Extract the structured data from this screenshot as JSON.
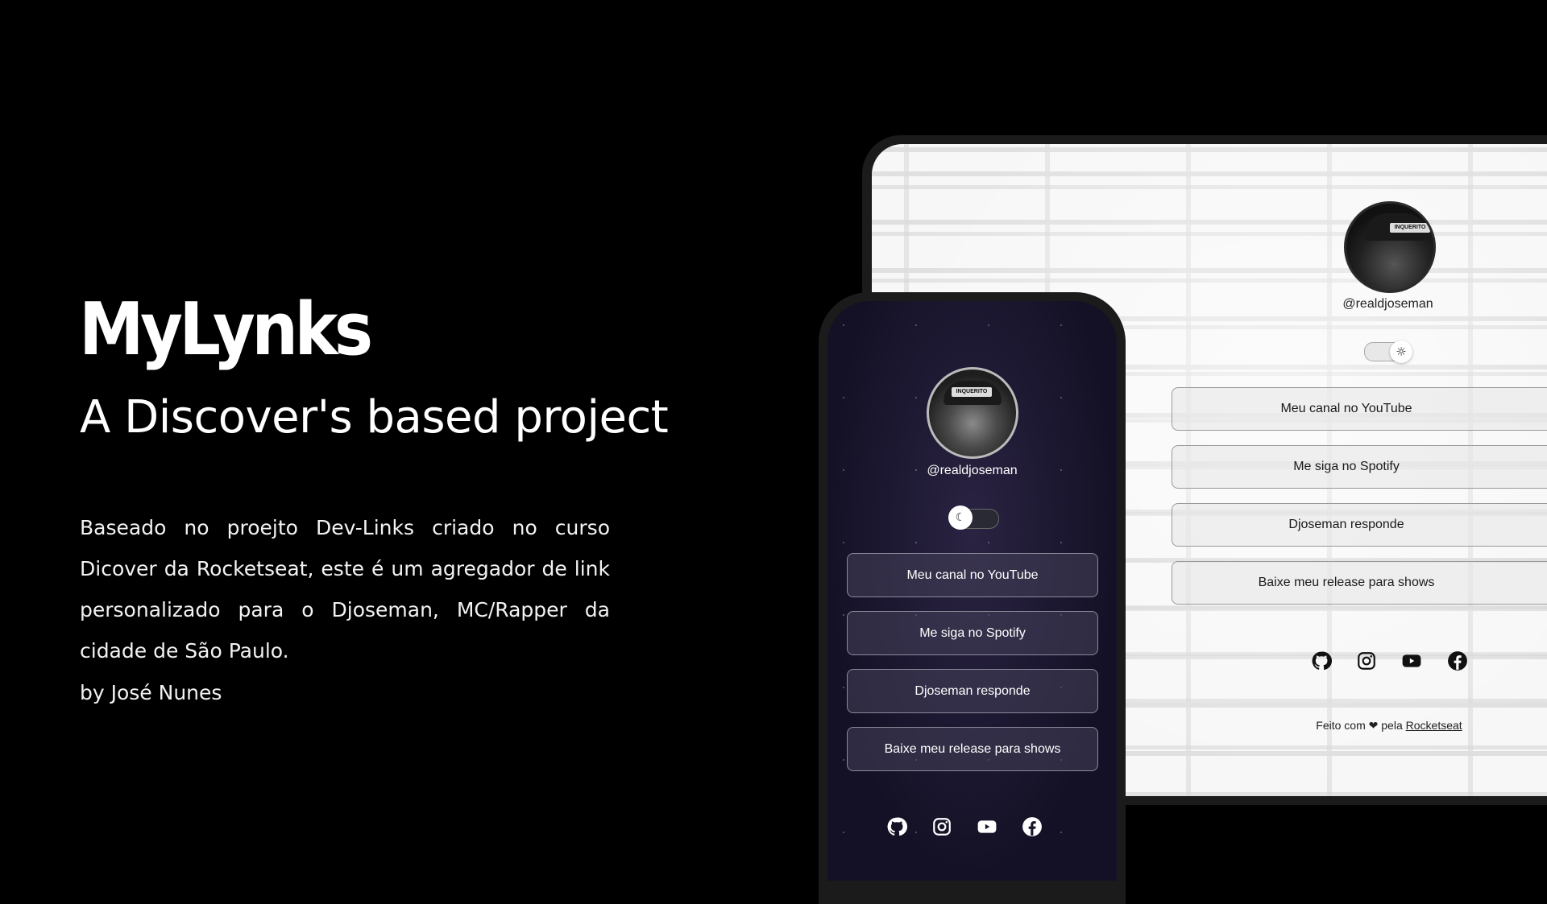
{
  "hero": {
    "title": "MyLynks",
    "subtitle": "A Discover's based project",
    "description": "Baseado no proejto Dev-Links criado no curso Dicover da Rocketseat, este é um agregador de link personalizado para o Djoseman, MC/Rapper da cidade de São Paulo.",
    "author": "by José Nunes"
  },
  "desktop": {
    "username": "@realdjoseman",
    "theme_toggle_icon": "sun-icon",
    "links": [
      {
        "label": "Meu canal no YouTube"
      },
      {
        "label": "Me siga no Spotify"
      },
      {
        "label": "Djoseman responde"
      },
      {
        "label": "Baixe meu release para shows"
      }
    ],
    "social": [
      "github-icon",
      "instagram-icon",
      "youtube-icon",
      "facebook-icon"
    ],
    "footer": {
      "prefix": "Feito com ❤ pela",
      "link": "Rocketseat"
    },
    "cap_text": "INQUERITO"
  },
  "mobile": {
    "username": "@realdjoseman",
    "theme_toggle_icon": "moon-icon",
    "links": [
      {
        "label": "Meu canal no YouTube"
      },
      {
        "label": "Me siga no Spotify"
      },
      {
        "label": "Djoseman responde"
      },
      {
        "label": "Baixe meu release para shows"
      }
    ],
    "social": [
      "github-icon",
      "instagram-icon",
      "youtube-icon",
      "facebook-icon"
    ],
    "cap_text": "INQUERITO"
  },
  "colors": {
    "background": "#000000",
    "mobile_bg": "#17142a",
    "desktop_bg": "#f1f1f1"
  }
}
